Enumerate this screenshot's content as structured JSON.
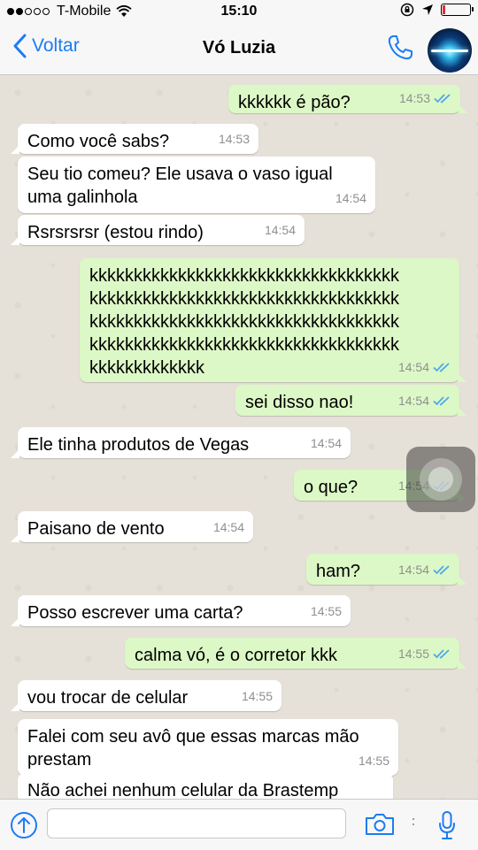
{
  "status_bar": {
    "carrier": "T-Mobile",
    "time": "15:10",
    "signal_bars_filled": 2,
    "signal_bars_total": 5,
    "battery_level": 0.1
  },
  "header": {
    "back_label": "Voltar",
    "contact_name": "Vó Luzia",
    "call_icon": "phone-icon",
    "avatar": "contact-avatar"
  },
  "messages": [
    {
      "dir": "out",
      "text": "kkkkkk é pão?",
      "time": "14:53",
      "read": true
    },
    {
      "dir": "in",
      "text": "Como você sabs?",
      "time": "14:53"
    },
    {
      "dir": "in",
      "text": "Seu tio comeu? Ele usava o vaso igual\numa galinhola",
      "time": "14:54"
    },
    {
      "dir": "in",
      "text": "Rsrsrsrsr (estou rindo)",
      "time": "14:54"
    },
    {
      "dir": "out",
      "text": "kkkkkkkkkkkkkkkkkkkkkkkkkkkkkkkkkkk\nkkkkkkkkkkkkkkkkkkkkkkkkkkkkkkkkkkk\nkkkkkkkkkkkkkkkkkkkkkkkkkkkkkkkkkkk\nkkkkkkkkkkkkkkkkkkkkkkkkkkkkkkkkkkk\nkkkkkkkkkkkkk",
      "time": "14:54",
      "read": true
    },
    {
      "dir": "out",
      "text": "sei disso nao!",
      "time": "14:54",
      "read": true
    },
    {
      "dir": "in",
      "text": "Ele tinha produtos de Vegas",
      "time": "14:54"
    },
    {
      "dir": "out",
      "text": "o que?",
      "time": "14:54",
      "read": true
    },
    {
      "dir": "in",
      "text": "Paisano de vento",
      "time": "14:54"
    },
    {
      "dir": "out",
      "text": "ham?",
      "time": "14:54",
      "read": true
    },
    {
      "dir": "in",
      "text": "Posso escrever uma carta?",
      "time": "14:55"
    },
    {
      "dir": "out",
      "text": "calma vó, é o corretor kkk",
      "time": "14:55",
      "read": true
    },
    {
      "dir": "in",
      "text": "vou trocar de celular",
      "time": "14:55"
    },
    {
      "dir": "in",
      "text": "Falei com seu avô que essas marcas mão\nprestam",
      "time": "14:55"
    },
    {
      "dir": "in",
      "text": "Não achei nenhum celular da Brastemp",
      "time": ""
    }
  ],
  "input_bar": {
    "upload_icon": "upload-arrow-icon",
    "placeholder": "",
    "camera_icon": "camera-icon",
    "mic_icon": "microphone-icon"
  },
  "colors": {
    "accent": "#1d7cf2",
    "incoming_bubble": "#ffffff",
    "outgoing_bubble": "#dcf8c6",
    "read_ticks": "#4fa8e8",
    "chat_background": "#e6e1d8"
  }
}
